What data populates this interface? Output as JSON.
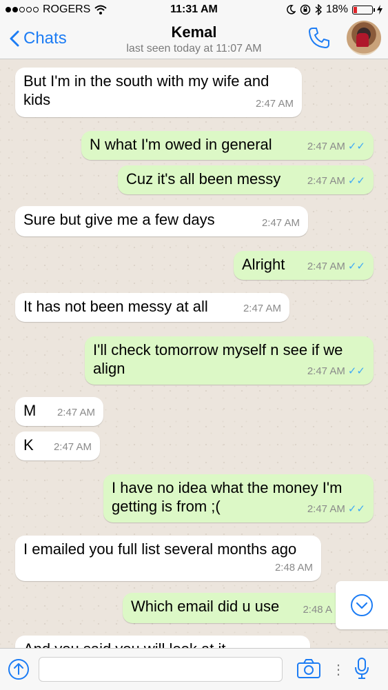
{
  "status_bar": {
    "carrier": "ROGERS",
    "time": "11:31 AM",
    "battery": "18%",
    "battery_level": 0.18
  },
  "header": {
    "back_label": "Chats",
    "contact_name": "Kemal",
    "last_seen": "last seen today at 11:07 AM"
  },
  "messages": [
    {
      "direction": "in",
      "text": "But I'm in the south with my wife and kids",
      "time": "2:47 AM"
    },
    {
      "direction": "out",
      "text": "N what I'm owed in general",
      "time": "2:47 AM"
    },
    {
      "direction": "out",
      "text": "Cuz it's all been messy",
      "time": "2:47 AM"
    },
    {
      "direction": "in",
      "text": "Sure but give me a few days",
      "time": "2:47 AM"
    },
    {
      "direction": "out",
      "text": "Alright",
      "time": "2:47 AM"
    },
    {
      "direction": "in",
      "text": "It has not been messy at all",
      "time": "2:47 AM"
    },
    {
      "direction": "out",
      "text": "I'll check tomorrow myself n see if we align",
      "time": "2:47 AM"
    },
    {
      "direction": "in",
      "text": "M",
      "time": "2:47 AM"
    },
    {
      "direction": "in",
      "text": "K",
      "time": "2:47 AM"
    },
    {
      "direction": "out",
      "text": "I have no idea what the money I'm getting is from ;(",
      "time": "2:47 AM"
    },
    {
      "direction": "in",
      "text": "I emailed you full list several months ago",
      "time": "2:48 AM"
    },
    {
      "direction": "out",
      "text": "Which email did u use",
      "time": "2:48 A"
    },
    {
      "direction": "in",
      "text": "And you said you will look at it",
      "time": ""
    }
  ],
  "read_ticks": "✓✓",
  "input": {
    "placeholder": ""
  },
  "colors": {
    "accent": "#1c7cf4",
    "outgoing_bubble": "#dcf8c6",
    "incoming_bubble": "#ffffff",
    "read_ticks": "#3fa9f5"
  },
  "icons": [
    "signal-dots-icon",
    "wifi-icon",
    "moon-icon",
    "rotation-lock-icon",
    "bluetooth-icon",
    "battery-icon",
    "chevron-left-icon",
    "phone-icon",
    "arrow-up-icon",
    "camera-icon",
    "microphone-icon",
    "chevron-down-circle-icon"
  ]
}
